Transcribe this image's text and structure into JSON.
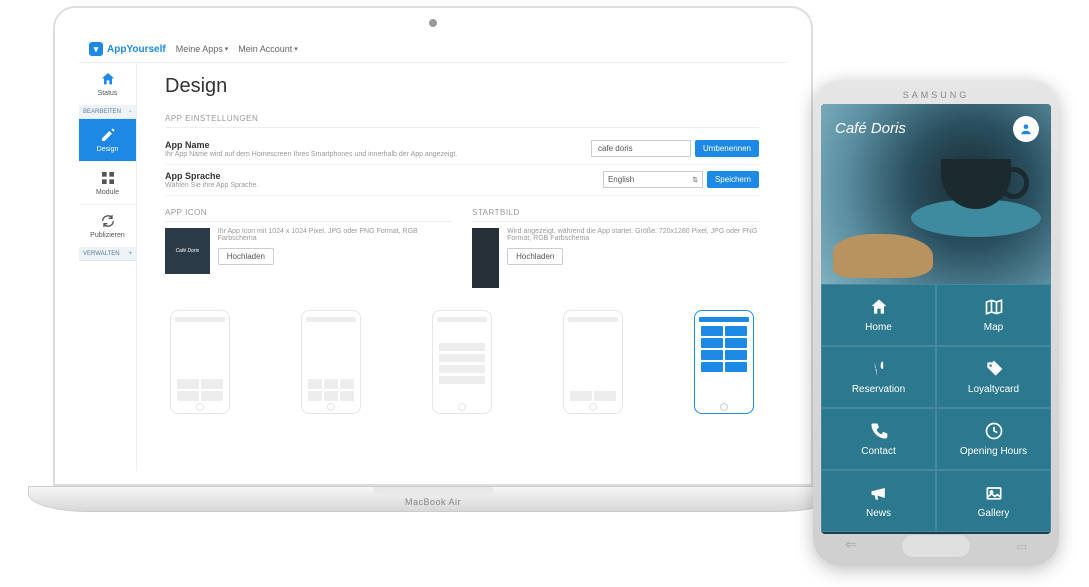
{
  "laptop_model": "MacBook Air",
  "brand": "AppYourself",
  "topnav": {
    "meine_apps": "Meine Apps",
    "mein_account": "Mein Account"
  },
  "sidebar": {
    "status": "Status",
    "bearbeiten": "BEARBEITEN",
    "design": "Design",
    "module": "Module",
    "publizieren": "Publizieren",
    "verwalten": "VERWALTEN"
  },
  "page": {
    "title": "Design",
    "settings_header": "APP EINSTELLUNGEN",
    "app_name_label": "App Name",
    "app_name_desc": "Ihr App Name wird auf dem Homescreen Ihres Smartphones und innerhalb der App angezeigt.",
    "app_name_value": "cafe doris",
    "rename_btn": "Umbenennen",
    "app_lang_label": "App Sprache",
    "app_lang_desc": "Wählen Sie ihre App Sprache.",
    "app_lang_value": "English",
    "save_btn": "Speichern",
    "icon_header": "APP ICON",
    "icon_desc": "Ihr App Icon mit 1024 x 1024 Pixel, JPG oder PNG Format, RGB Farbschema",
    "icon_thumb_text": "Café Doris",
    "upload_btn": "Hochladen",
    "startbild_header": "STARTBILD",
    "startbild_desc": "Wird angezeigt, während die App startet. Größe: 720x1280 Pixel, JPG oder PNG Format, RGB Farbschema"
  },
  "phone": {
    "brand": "SAMSUNG",
    "logo": "Café Doris",
    "tiles": {
      "home": "Home",
      "map": "Map",
      "reservation": "Reservation",
      "loyalty": "Loyaltycard",
      "contact": "Contact",
      "hours": "Opening Hours",
      "news": "News",
      "gallery": "Gallery"
    }
  }
}
